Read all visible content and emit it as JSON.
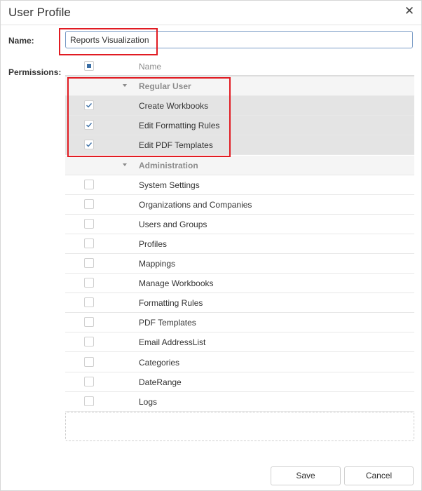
{
  "dialog": {
    "title": "User Profile"
  },
  "form": {
    "name_label": "Name:",
    "name_value": "Reports Visualization",
    "permissions_label": "Permissions:"
  },
  "grid": {
    "column_header": "Name",
    "header_checkbox_state": "indeterminate",
    "groups": [
      {
        "label": "Regular User",
        "items": [
          {
            "label": "Create Workbooks",
            "checked": true
          },
          {
            "label": "Edit Formatting Rules",
            "checked": true
          },
          {
            "label": "Edit PDF Templates",
            "checked": true
          }
        ]
      },
      {
        "label": "Administration",
        "items": [
          {
            "label": "System Settings",
            "checked": false
          },
          {
            "label": "Organizations and Companies",
            "checked": false
          },
          {
            "label": "Users and Groups",
            "checked": false
          },
          {
            "label": "Profiles",
            "checked": false
          },
          {
            "label": "Mappings",
            "checked": false
          },
          {
            "label": "Manage Workbooks",
            "checked": false
          },
          {
            "label": "Formatting Rules",
            "checked": false
          },
          {
            "label": "PDF Templates",
            "checked": false
          },
          {
            "label": "Email AddressList",
            "checked": false
          },
          {
            "label": "Categories",
            "checked": false
          },
          {
            "label": "DateRange",
            "checked": false
          },
          {
            "label": "Logs",
            "checked": false
          }
        ]
      }
    ]
  },
  "buttons": {
    "save": "Save",
    "cancel": "Cancel"
  },
  "colors": {
    "highlight": "#e11b22",
    "checkbox_mark": "#3a6ea5",
    "selected_row": "#e4e4e4"
  }
}
